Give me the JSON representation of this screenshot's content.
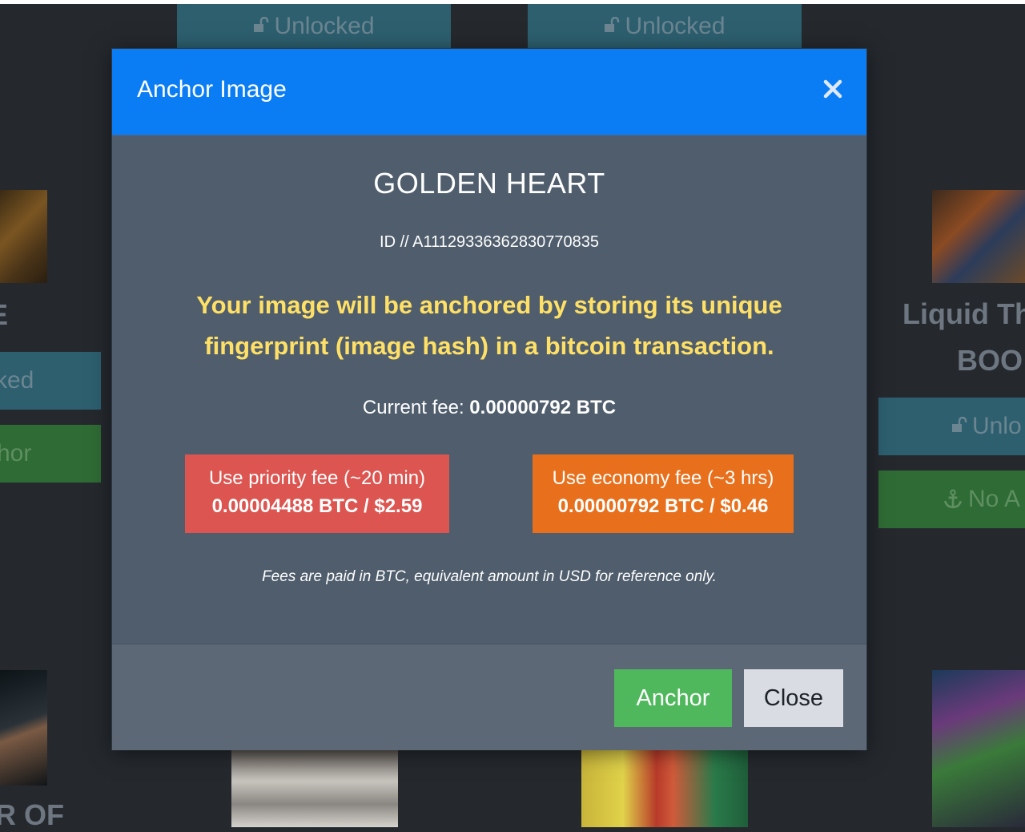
{
  "background": {
    "unlocked_label": "Unlocked",
    "unlocked_partial_left": "ked",
    "unlocked_partial_right": "Unlo",
    "anchor_partial_left": "hor",
    "no_anchor_partial_right": "No A",
    "title_partial_left_1": "E",
    "title_partial_left_2": "R OF",
    "title_partial_right_1": "Liquid Th",
    "title_partial_right_2": "BOO"
  },
  "modal": {
    "title": "Anchor Image",
    "image_name": "GOLDEN HEART",
    "image_id": "ID // A11129336362830770835",
    "notice": "Your image will be anchored by storing its unique fingerprint (image hash) in a bitcoin transaction.",
    "current_fee_label": "Current fee:",
    "current_fee_value": "0.00000792 BTC",
    "priority_fee": {
      "label": "Use priority fee (~20 min)",
      "value": "0.00004488 BTC / $2.59"
    },
    "economy_fee": {
      "label": "Use economy fee (~3 hrs)",
      "value": "0.00000792 BTC / $0.46"
    },
    "fee_note": "Fees are paid in BTC, equivalent amount in USD for reference only.",
    "anchor_button": "Anchor",
    "close_button": "Close"
  },
  "colors": {
    "header": "#0a7df5",
    "notice": "#ffe066",
    "priority": "#dc5550",
    "economy": "#e8701c",
    "anchor": "#4fb85c",
    "close": "#d9dce2"
  },
  "icons": [
    "unlock-icon",
    "anchor-icon",
    "close-icon"
  ]
}
